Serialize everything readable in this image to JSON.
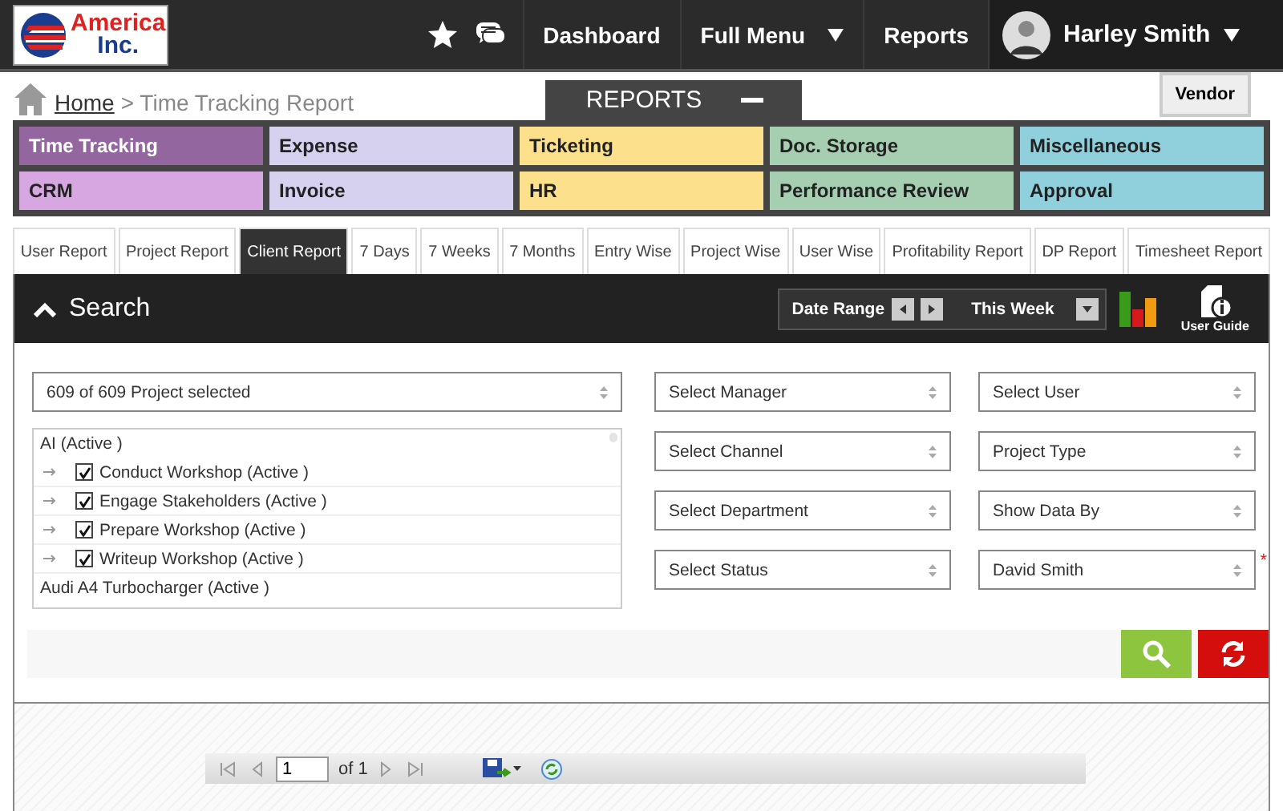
{
  "header": {
    "logo": {
      "line_1": "America",
      "line_2": "Inc."
    },
    "nav": [
      {
        "label": "Dashboard",
        "has_menu": false
      },
      {
        "label": "Full Menu",
        "has_menu": true
      },
      {
        "label": "Reports",
        "has_menu": false
      }
    ],
    "user": {
      "name": "Harley Smith",
      "has_menu": true
    }
  },
  "breadcrumb": {
    "home": "Home",
    "separator": ">",
    "current": "Time Tracking Report"
  },
  "reports_panel": {
    "title": "REPORTS",
    "expanded": true
  },
  "vendor_button": "Vendor",
  "categories": [
    {
      "label": "Time Tracking",
      "color": "#9466a0",
      "selected": true
    },
    {
      "label": "Expense",
      "color": "#d5d1ef",
      "selected": false
    },
    {
      "label": "Ticketing",
      "color": "#fde08c",
      "selected": false
    },
    {
      "label": "Doc. Storage",
      "color": "#a6cfb2",
      "selected": false
    },
    {
      "label": "Miscellaneous",
      "color": "#90d0dd",
      "selected": false
    },
    {
      "label": "CRM",
      "color": "#d7a7e2",
      "selected": false
    },
    {
      "label": "Invoice",
      "color": "#d5d1ef",
      "selected": false
    },
    {
      "label": "HR",
      "color": "#fde08c",
      "selected": false
    },
    {
      "label": "Performance Review",
      "color": "#a6cfb2",
      "selected": false
    },
    {
      "label": "Approval",
      "color": "#90d0dd",
      "selected": false
    }
  ],
  "tabs": [
    {
      "label": "User Report",
      "selected": false
    },
    {
      "label": "Project Report",
      "selected": false
    },
    {
      "label": "Client Report",
      "selected": true
    },
    {
      "label": "7 Days",
      "selected": false
    },
    {
      "label": "7 Weeks",
      "selected": false
    },
    {
      "label": "7 Months",
      "selected": false
    },
    {
      "label": "Entry Wise",
      "selected": false
    },
    {
      "label": "Project Wise",
      "selected": false
    },
    {
      "label": "User Wise",
      "selected": false
    },
    {
      "label": "Profitability Report",
      "selected": false
    },
    {
      "label": "DP Report",
      "selected": false
    },
    {
      "label": "Timesheet Report",
      "selected": false
    }
  ],
  "search": {
    "title": "Search",
    "expanded": true,
    "date_range": {
      "label": "Date Range",
      "period": "This Week"
    },
    "user_guide": "User Guide",
    "project_select": "609 of 609 Project selected",
    "project_tree": [
      {
        "label": "AI (Active )",
        "children": [
          {
            "label": "Conduct Workshop (Active )",
            "checked": true
          },
          {
            "label": "Engage Stakeholders (Active )",
            "checked": true
          },
          {
            "label": "Prepare Workshop (Active )",
            "checked": true
          },
          {
            "label": "Writeup Workshop (Active )",
            "checked": true
          }
        ]
      },
      {
        "label": "Audi A4 Turbocharger (Active )"
      }
    ],
    "filters": [
      {
        "label": "Select Manager",
        "required": false
      },
      {
        "label": "Select User",
        "required": false
      },
      {
        "label": "Select Channel",
        "required": false
      },
      {
        "label": "Project Type",
        "required": false
      },
      {
        "label": "Select Department",
        "required": false
      },
      {
        "label": "Show Data By",
        "required": false
      },
      {
        "label": "Select Status",
        "required": false
      },
      {
        "label": "David Smith",
        "required": true,
        "required_mark": "*"
      }
    ]
  },
  "pager": {
    "page": "1",
    "total": "of 1"
  }
}
